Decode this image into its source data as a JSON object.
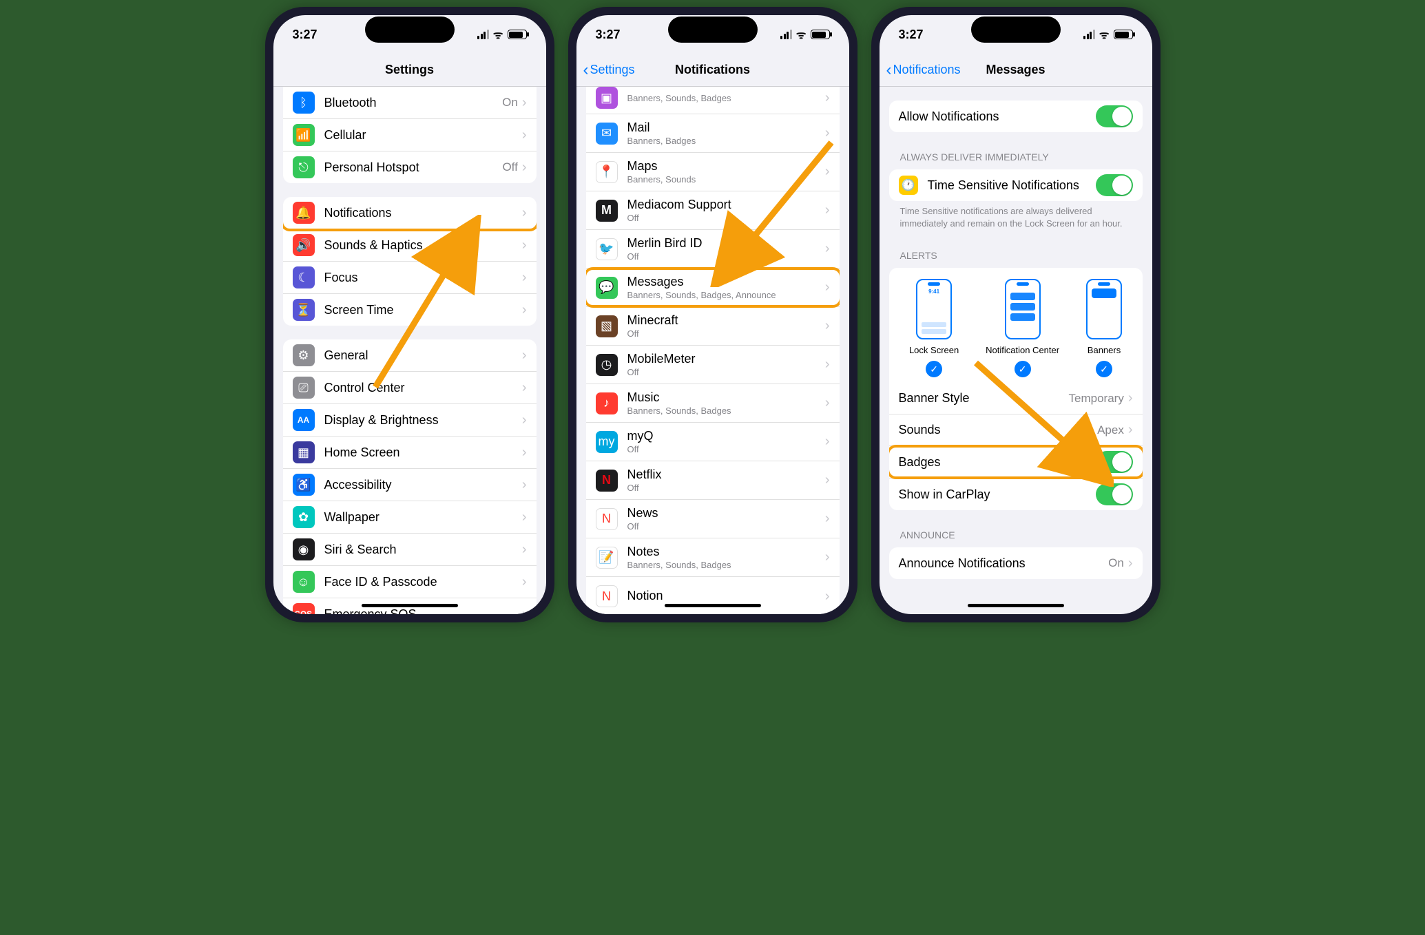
{
  "status": {
    "time": "3:27"
  },
  "phone1": {
    "title": "Settings",
    "groups": [
      {
        "items": [
          {
            "icon": "bluetooth",
            "bg": "#007aff",
            "label": "Bluetooth",
            "value": "On"
          },
          {
            "icon": "cellular",
            "bg": "#34c759",
            "label": "Cellular"
          },
          {
            "icon": "hotspot",
            "bg": "#34c759",
            "label": "Personal Hotspot",
            "value": "Off"
          }
        ]
      },
      {
        "items": [
          {
            "icon": "bell",
            "bg": "#ff3b30",
            "label": "Notifications",
            "highlight": true
          },
          {
            "icon": "speaker",
            "bg": "#ff3b30",
            "label": "Sounds & Haptics"
          },
          {
            "icon": "moon",
            "bg": "#5856d6",
            "label": "Focus"
          },
          {
            "icon": "hourglass",
            "bg": "#5856d6",
            "label": "Screen Time"
          }
        ]
      },
      {
        "items": [
          {
            "icon": "gear",
            "bg": "#8e8e93",
            "label": "General"
          },
          {
            "icon": "switches",
            "bg": "#8e8e93",
            "label": "Control Center"
          },
          {
            "icon": "aa",
            "bg": "#007aff",
            "label": "Display & Brightness"
          },
          {
            "icon": "grid",
            "bg": "#3a3a9e",
            "label": "Home Screen"
          },
          {
            "icon": "person",
            "bg": "#007aff",
            "label": "Accessibility"
          },
          {
            "icon": "flower",
            "bg": "#00c7be",
            "label": "Wallpaper"
          },
          {
            "icon": "siri",
            "bg": "#1c1c1e",
            "label": "Siri & Search"
          },
          {
            "icon": "faceid",
            "bg": "#34c759",
            "label": "Face ID & Passcode"
          },
          {
            "icon": "sos",
            "bg": "#ff3b30",
            "label": "Emergency SOS"
          }
        ]
      }
    ]
  },
  "phone2": {
    "back": "Settings",
    "title": "Notifications",
    "items": [
      {
        "icon": "app",
        "bg": "#af52de",
        "label": "",
        "sub": "Banners, Sounds, Badges",
        "partial": true
      },
      {
        "icon": "mail",
        "bg": "#1f8fff",
        "label": "Mail",
        "sub": "Banners, Badges"
      },
      {
        "icon": "maps",
        "bg": "#fff",
        "label": "Maps",
        "sub": "Banners, Sounds"
      },
      {
        "icon": "m",
        "bg": "#1c1c1e",
        "label": "Mediacom Support",
        "sub": "Off"
      },
      {
        "icon": "merlin",
        "bg": "#fff",
        "label": "Merlin Bird ID",
        "sub": "Off"
      },
      {
        "icon": "messages",
        "bg": "#34c759",
        "label": "Messages",
        "sub": "Banners, Sounds, Badges, Announce",
        "highlight": true
      },
      {
        "icon": "minecraft",
        "bg": "#6b4226",
        "label": "Minecraft",
        "sub": "Off"
      },
      {
        "icon": "mobilemeter",
        "bg": "#1c1c1e",
        "label": "MobileMeter",
        "sub": "Off"
      },
      {
        "icon": "music",
        "bg": "#ff3b30",
        "label": "Music",
        "sub": "Banners, Sounds, Badges"
      },
      {
        "icon": "myq",
        "bg": "#00a8e0",
        "label": "myQ",
        "sub": "Off"
      },
      {
        "icon": "netflix",
        "bg": "#1c1c1e",
        "label": "Netflix",
        "sub": "Off"
      },
      {
        "icon": "news",
        "bg": "#fff",
        "label": "News",
        "sub": "Off"
      },
      {
        "icon": "notes",
        "bg": "#fff",
        "label": "Notes",
        "sub": "Banners, Sounds, Badges"
      },
      {
        "icon": "notion",
        "bg": "#fff",
        "label": "Notion",
        "sub": "",
        "partial": true
      }
    ]
  },
  "phone3": {
    "back": "Notifications",
    "title": "Messages",
    "allow": "Allow Notifications",
    "always_header": "ALWAYS DELIVER IMMEDIATELY",
    "timesensitive": "Time Sensitive Notifications",
    "ts_footer": "Time Sensitive notifications are always delivered immediately and remain on the Lock Screen for an hour.",
    "alerts_header": "ALERTS",
    "alerts": {
      "lock": "Lock Screen",
      "nc": "Notification Center",
      "banners": "Banners",
      "time": "9:41"
    },
    "banner_style": {
      "label": "Banner Style",
      "value": "Temporary"
    },
    "sounds": {
      "label": "Sounds",
      "value": "Apex"
    },
    "badges": "Badges",
    "carplay": "Show in CarPlay",
    "announce_header": "ANNOUNCE",
    "announce": {
      "label": "Announce Notifications",
      "value": "On"
    }
  }
}
